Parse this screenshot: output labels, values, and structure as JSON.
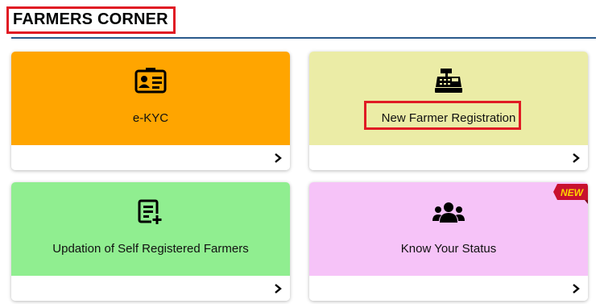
{
  "header": {
    "title": "FARMERS CORNER"
  },
  "cards": [
    {
      "label": "e-KYC",
      "icon": "id-card-icon",
      "color": "#ffa500"
    },
    {
      "label": "New Farmer Registration",
      "icon": "cash-register-icon",
      "color": "#ebeca6",
      "highlighted": true
    },
    {
      "label": "Updation of Self Registered Farmers",
      "icon": "list-add-icon",
      "color": "#90ee90"
    },
    {
      "label": "Know Your Status",
      "icon": "users-group-icon",
      "color": "#f6c3f8",
      "badge": "NEW"
    }
  ],
  "accent": {
    "highlight": "#e01b24",
    "rule": "#2a5a8c"
  }
}
